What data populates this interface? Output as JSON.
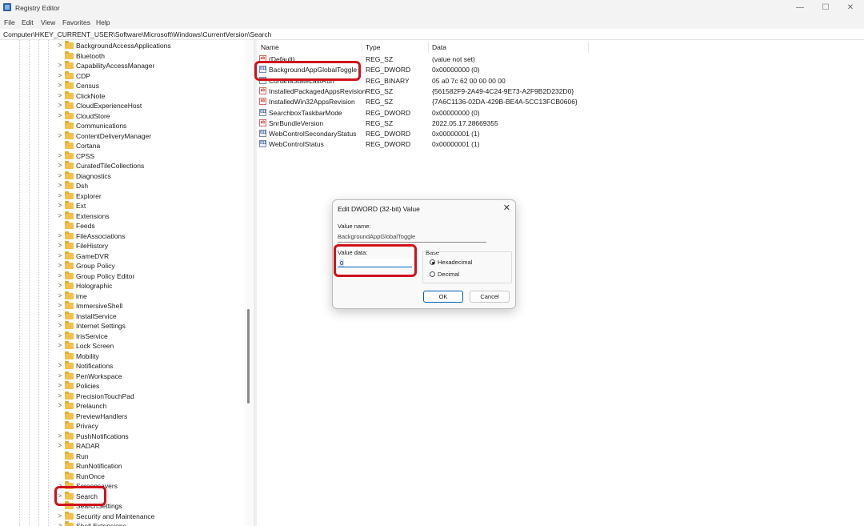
{
  "window": {
    "title": "Registry Editor",
    "minimize_glyph": "—",
    "maximize_glyph": "☐",
    "close_glyph": "✕"
  },
  "menu": [
    "File",
    "Edit",
    "View",
    "Favorites",
    "Help"
  ],
  "address": "Computer\\HKEY_CURRENT_USER\\Software\\Microsoft\\Windows\\CurrentVersion\\Search",
  "tree": {
    "items": [
      {
        "label": "BackgroundAccessApplications",
        "chevron": ">"
      },
      {
        "label": "Bluetooth",
        "chevron": ""
      },
      {
        "label": "CapabilityAccessManager",
        "chevron": ">"
      },
      {
        "label": "CDP",
        "chevron": ">"
      },
      {
        "label": "Census",
        "chevron": ">"
      },
      {
        "label": "ClickNote",
        "chevron": ">"
      },
      {
        "label": "CloudExperienceHost",
        "chevron": ">"
      },
      {
        "label": "CloudStore",
        "chevron": ">"
      },
      {
        "label": "Communications",
        "chevron": ""
      },
      {
        "label": "ContentDeliveryManager",
        "chevron": ">"
      },
      {
        "label": "Cortana",
        "chevron": ""
      },
      {
        "label": "CPSS",
        "chevron": ">"
      },
      {
        "label": "CuratedTileCollections",
        "chevron": ">"
      },
      {
        "label": "Diagnostics",
        "chevron": ">"
      },
      {
        "label": "Dsh",
        "chevron": ">"
      },
      {
        "label": "Explorer",
        "chevron": ">"
      },
      {
        "label": "Ext",
        "chevron": ">"
      },
      {
        "label": "Extensions",
        "chevron": ">"
      },
      {
        "label": "Feeds",
        "chevron": ""
      },
      {
        "label": "FileAssociations",
        "chevron": ">"
      },
      {
        "label": "FileHistory",
        "chevron": ">"
      },
      {
        "label": "GameDVR",
        "chevron": ">"
      },
      {
        "label": "Group Policy",
        "chevron": ">"
      },
      {
        "label": "Group Policy Editor",
        "chevron": ">"
      },
      {
        "label": "Holographic",
        "chevron": ">"
      },
      {
        "label": "ime",
        "chevron": ">"
      },
      {
        "label": "ImmersiveShell",
        "chevron": ">"
      },
      {
        "label": "InstallService",
        "chevron": ">"
      },
      {
        "label": "Internet Settings",
        "chevron": ">"
      },
      {
        "label": "IrisService",
        "chevron": ">"
      },
      {
        "label": "Lock Screen",
        "chevron": ">"
      },
      {
        "label": "Mobility",
        "chevron": ""
      },
      {
        "label": "Notifications",
        "chevron": ">"
      },
      {
        "label": "PenWorkspace",
        "chevron": ">"
      },
      {
        "label": "Policies",
        "chevron": ">"
      },
      {
        "label": "PrecisionTouchPad",
        "chevron": ">"
      },
      {
        "label": "Prelaunch",
        "chevron": ">"
      },
      {
        "label": "PreviewHandlers",
        "chevron": ""
      },
      {
        "label": "Privacy",
        "chevron": ""
      },
      {
        "label": "PushNotifications",
        "chevron": ">"
      },
      {
        "label": "RADAR",
        "chevron": ">"
      },
      {
        "label": "Run",
        "chevron": ""
      },
      {
        "label": "RunNotification",
        "chevron": ""
      },
      {
        "label": "RunOnce",
        "chevron": ""
      },
      {
        "label": "Screensavers",
        "chevron": ">"
      },
      {
        "label": "Search",
        "chevron": ">"
      },
      {
        "label": "SearchSettings",
        "chevron": ""
      },
      {
        "label": "Security and Maintenance",
        "chevron": ">"
      },
      {
        "label": "Shell Extensions",
        "chevron": ">"
      }
    ]
  },
  "values": {
    "headers": {
      "name": "Name",
      "type": "Type",
      "data": "Data"
    },
    "rows": [
      {
        "icon": "ab",
        "name": "(Default)",
        "type": "REG_SZ",
        "data": "(value not set)"
      },
      {
        "icon": "011",
        "name": "BackgroundAppGlobalToggle",
        "type": "REG_DWORD",
        "data": "0x00000000 (0)"
      },
      {
        "icon": "011",
        "name": "CortanaStateLastRun",
        "type": "REG_BINARY",
        "data": "05 a0 7c 62 00 00 00 00"
      },
      {
        "icon": "ab",
        "name": "InstalledPackagedAppsRevision",
        "type": "REG_SZ",
        "data": "{561582F9-2A49-4C24-9E73-A2F9B2D232D0}"
      },
      {
        "icon": "ab",
        "name": "InstalledWin32AppsRevision",
        "type": "REG_SZ",
        "data": "{7A6C1136-02DA-429B-BE4A-5CC13FCB0606}"
      },
      {
        "icon": "011",
        "name": "SearchboxTaskbarMode",
        "type": "REG_DWORD",
        "data": "0x00000000 (0)"
      },
      {
        "icon": "ab",
        "name": "SnrBundleVersion",
        "type": "REG_SZ",
        "data": "2022.05.17.28669355"
      },
      {
        "icon": "011",
        "name": "WebControlSecondaryStatus",
        "type": "REG_DWORD",
        "data": "0x00000001 (1)"
      },
      {
        "icon": "011",
        "name": "WebControlStatus",
        "type": "REG_DWORD",
        "data": "0x00000001 (1)"
      }
    ]
  },
  "dialog": {
    "title": "Edit DWORD (32-bit) Value",
    "close_glyph": "✕",
    "value_name_label": "Value name:",
    "value_name": "BackgroundAppGlobalToggle",
    "value_data_label": "Value data:",
    "value_data": "0",
    "base_label": "Base",
    "hex_label": "Hexadecimal",
    "dec_label": "Decimal",
    "ok": "OK",
    "cancel": "Cancel"
  },
  "colors": {
    "highlight": "#d0121b",
    "accent": "#005fb8",
    "folder": "#f2c04b"
  }
}
